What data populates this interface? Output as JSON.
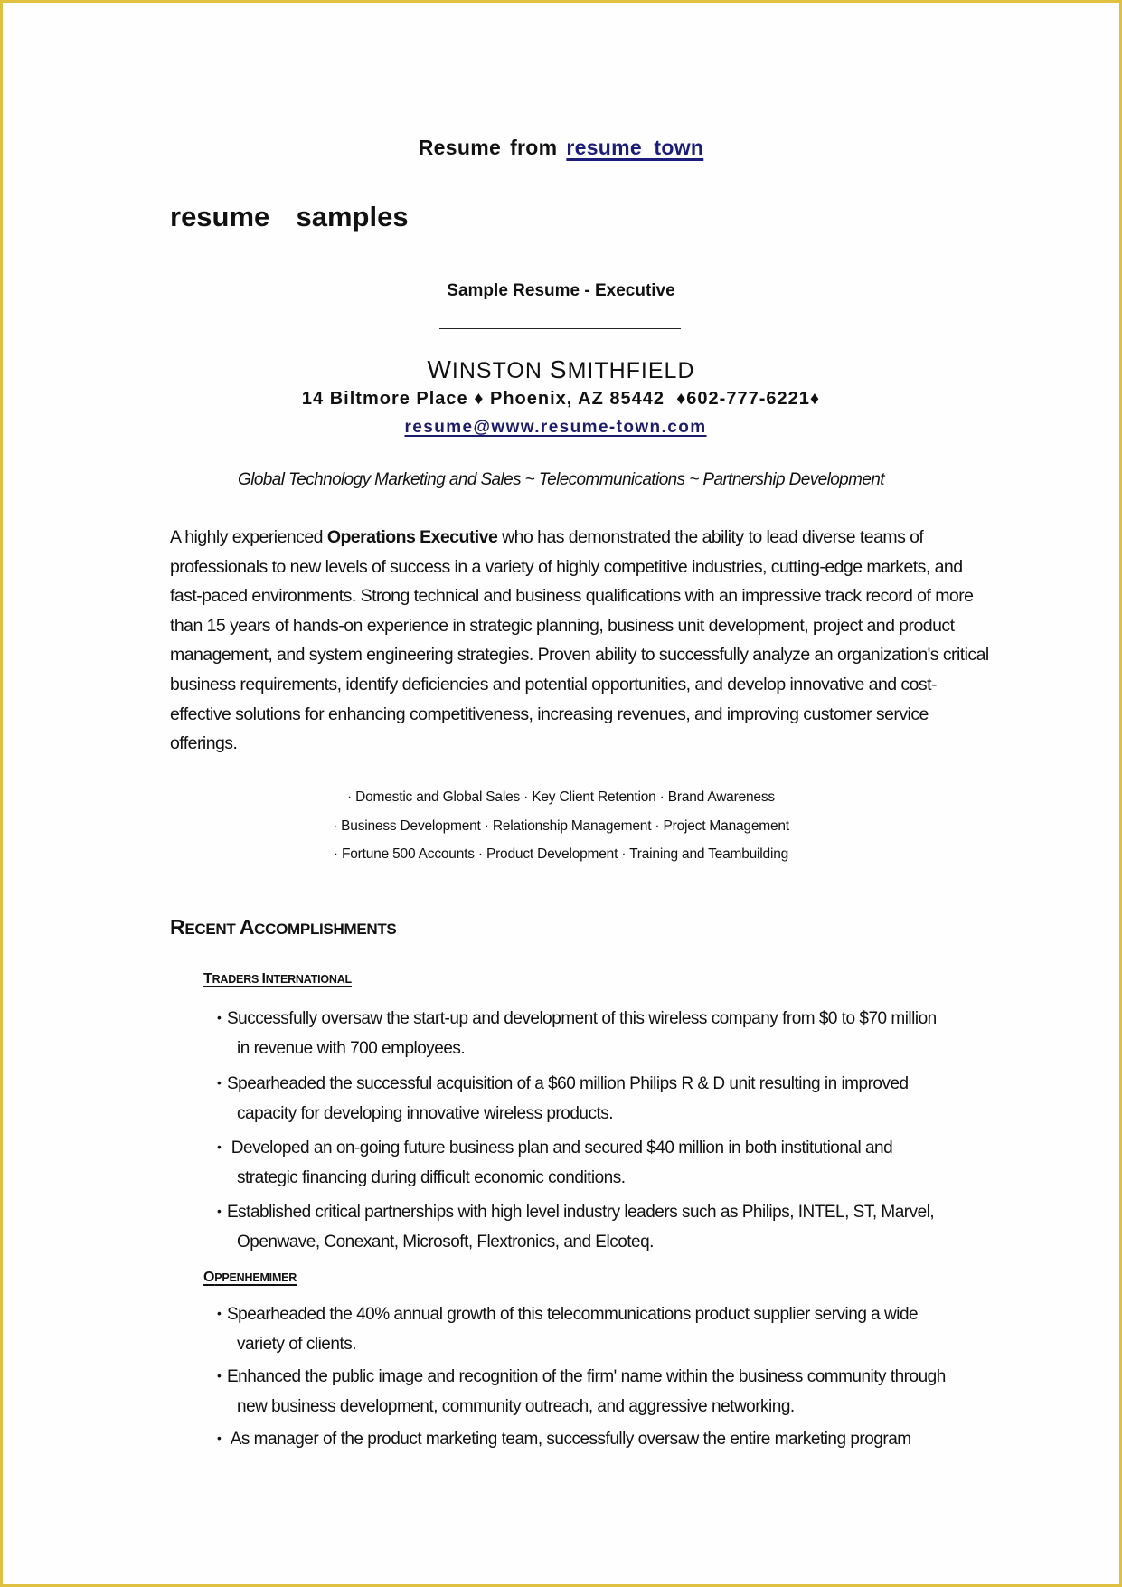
{
  "header": {
    "prefix": "Resume",
    "from": "from",
    "link_text": "resume  town"
  },
  "page_title": "resume  samples",
  "sample_title": "Sample Resume - Executive",
  "candidate": {
    "name_first_initial": "W",
    "name_first_rest": "INSTON",
    "name_last_initial": "S",
    "name_last_rest": "MITHFIELD",
    "address": "14 Biltmore Place ♦ Phoenix, AZ 85442  ♦602-777-6221♦",
    "email": "resume@www.resume-town.com"
  },
  "tagline": "Global Technology Marketing and Sales ~ Telecommunications ~ Partnership Development",
  "summary": {
    "before_bold": "A highly experienced ",
    "bold": "Operations Executive",
    "after_bold": " who has demonstrated the ability to lead diverse teams of professionals to new levels of success in a variety of highly competitive industries, cutting-edge markets, and fast-paced environments. Strong technical and business qualifications with an impressive track record of more than 15 years of hands-on experience in strategic planning, business unit development, project and product management, and system engineering strategies. Proven ability to successfully analyze an organization's critical business requirements, identify deficiencies and potential opportunities, and develop innovative and cost-effective solutions for enhancing competitiveness, increasing revenues, and improving customer service offerings."
  },
  "skills_lines": [
    "· Domestic and Global Sales · Key Client Retention · Brand Awareness",
    "· Business Development · Relationship Management · Project Management",
    "· Fortune 500 Accounts · Product Development ·  Training and Teambuilding"
  ],
  "section": {
    "title_r": "R",
    "title_ecent": "ECENT ",
    "title_a": "A",
    "title_ccomplishments": "CCOMPLISHMENTS"
  },
  "companies": [
    {
      "name_cap1": "T",
      "name_rest1": "RADERS ",
      "name_cap2": "I",
      "name_rest2": "NTERNATIONAL",
      "bullets": [
        {
          "first": "Successfully oversaw the start-up and development of this wireless company from $0 to $70 million",
          "cont": "in revenue with 700 employees."
        },
        {
          "first": "Spearheaded the successful acquisition of a $60 million Philips R & D unit resulting in improved",
          "cont": "capacity for developing innovative wireless products."
        },
        {
          "first": " Developed an on-going future business plan and secured $40 million in both institutional and",
          "cont": "strategic financing during difficult economic conditions."
        },
        {
          "first": "Established critical partnerships with high level industry leaders such as Philips, INTEL, ST, Marvel,",
          "cont": "Openwave, Conexant, Microsoft, Flextronics, and Elcoteq."
        }
      ]
    },
    {
      "name_cap1": "O",
      "name_rest1": "PPENHEMIMER",
      "name_cap2": "",
      "name_rest2": "",
      "bullets": [
        {
          "first": "Spearheaded the 40% annual growth of this telecommunications product supplier serving a wide",
          "cont": "variety of clients."
        },
        {
          "first": "Enhanced the public image and recognition of the firm' name within the business community through",
          "cont": "new business development, community outreach, and aggressive networking."
        },
        {
          "first": " As manager of the product marketing team, successfully oversaw the entire marketing program",
          "cont": ""
        }
      ]
    }
  ],
  "bullet_symbol": "•",
  "colors": {
    "link": "#1c1c7a",
    "frame_border": "#e0c040"
  }
}
